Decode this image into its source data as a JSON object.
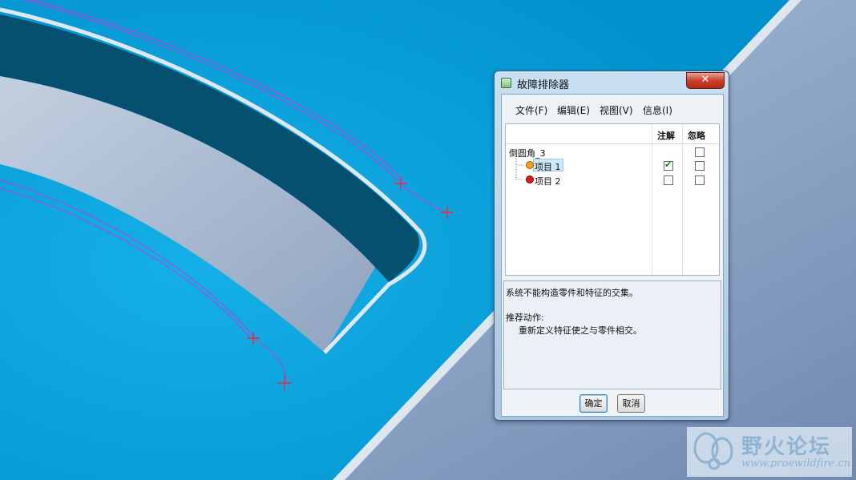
{
  "dialog": {
    "title": "故障排除器",
    "menu": [
      "文件(F)",
      "编辑(E)",
      "视图(V)",
      "信息(I)"
    ],
    "columns": {
      "annotate": "注解",
      "ignore": "忽略"
    },
    "tree": {
      "root": "倒圆角_3",
      "items": [
        {
          "label": "项目 1",
          "status_color": "#f0a020",
          "annotate": true,
          "ignore": false,
          "selected": true
        },
        {
          "label": "项目 2",
          "status_color": "#d02020",
          "annotate": false,
          "ignore": false,
          "selected": false
        }
      ]
    },
    "message": {
      "line1": "系统不能构造零件和特征的交集。",
      "heading": "推荐动作:",
      "action": "重新定义特征使之与零件相交。"
    },
    "buttons": {
      "ok": "确定",
      "cancel": "取消"
    },
    "close_glyph": "✕"
  },
  "watermark": {
    "title": "野火论坛",
    "url": "www.proewildfire.cn"
  }
}
